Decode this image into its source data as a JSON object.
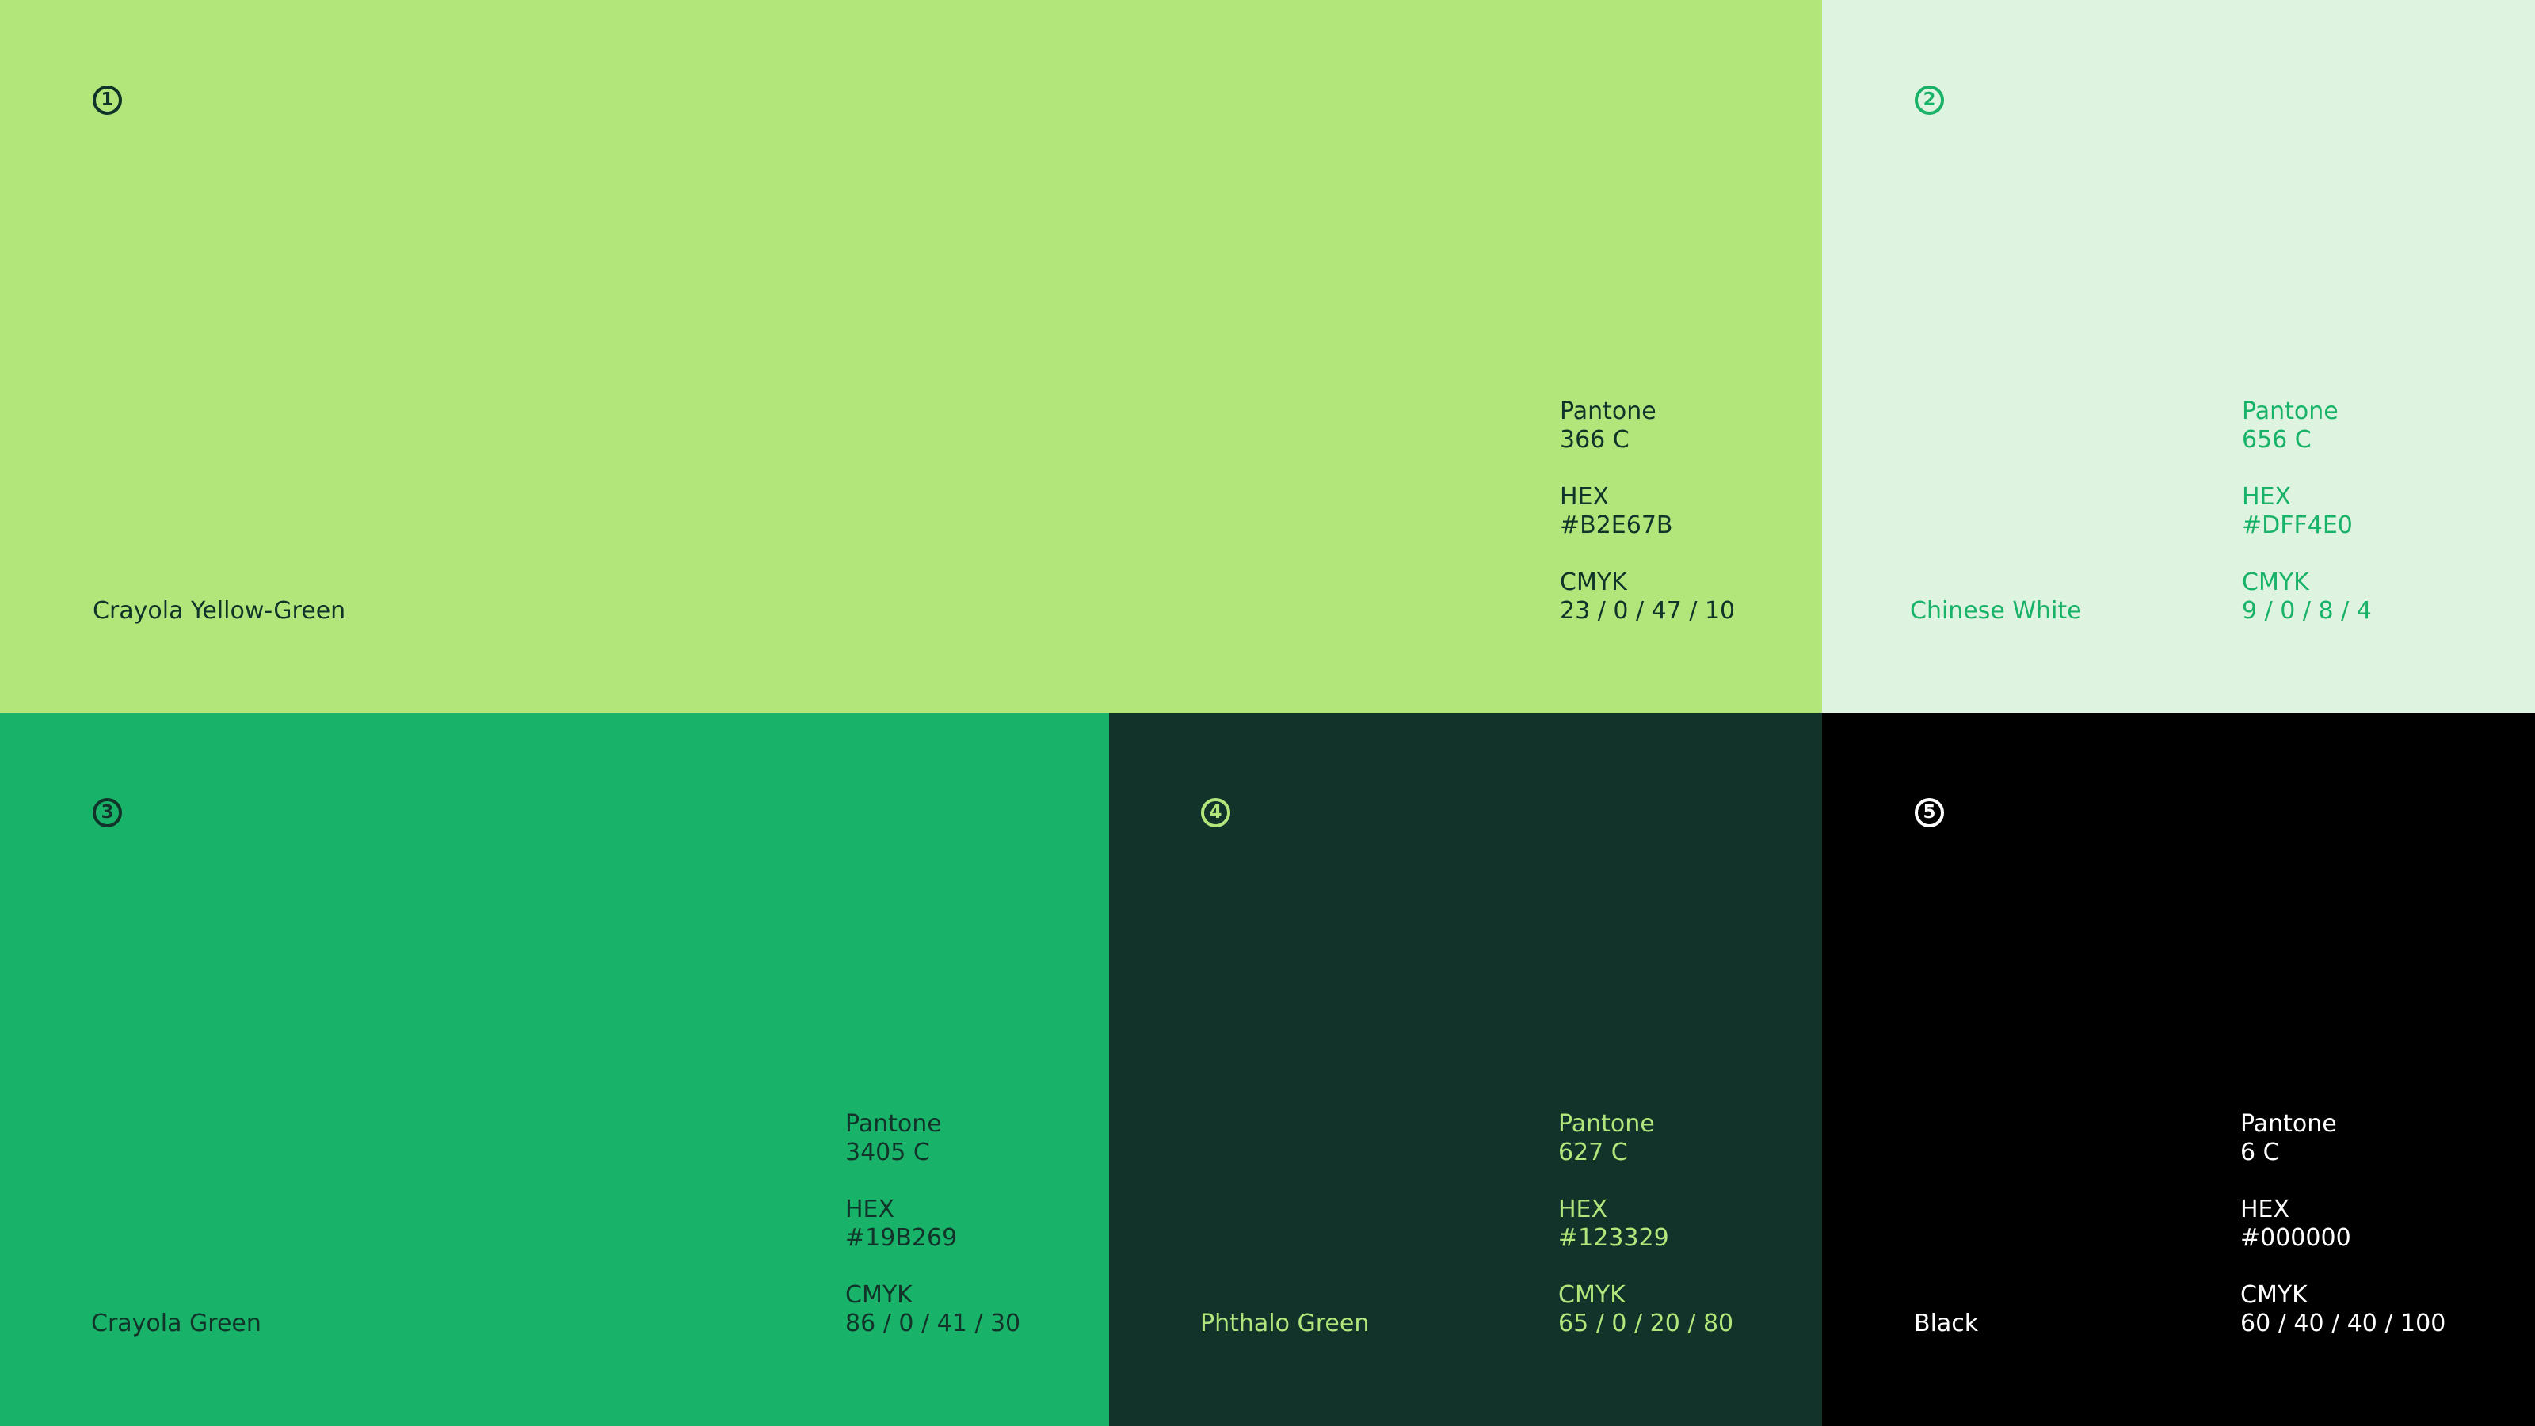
{
  "swatches": [
    {
      "number": "1",
      "name": "Crayola Yellow-Green",
      "pantone_label": "Pantone",
      "pantone": "366 C",
      "hex_label": "HEX",
      "hex": "#B2E67B",
      "cmyk_label": "CMYK",
      "cmyk": "23 / 0 / 47 / 10",
      "background": "#B2E67B",
      "text_color": "#123329"
    },
    {
      "number": "2",
      "name": "Chinese White",
      "pantone_label": "Pantone",
      "pantone": "656 C",
      "hex_label": "HEX",
      "hex": "#DFF4E0",
      "cmyk_label": "CMYK",
      "cmyk": "9 / 0 / 8 / 4",
      "background": "#DFF4E0",
      "text_color": "#19B269"
    },
    {
      "number": "3",
      "name": "Crayola Green",
      "pantone_label": "Pantone",
      "pantone": "3405 C",
      "hex_label": "HEX",
      "hex": "#19B269",
      "cmyk_label": "CMYK",
      "cmyk": "86 / 0 / 41 / 30",
      "background": "#19B269",
      "text_color": "#123329"
    },
    {
      "number": "4",
      "name": "Phthalo Green",
      "pantone_label": "Pantone",
      "pantone": "627 C",
      "hex_label": "HEX",
      "hex": "#123329",
      "cmyk_label": "CMYK",
      "cmyk": "65 / 0 / 20 / 80",
      "background": "#123329",
      "text_color": "#B2E67B"
    },
    {
      "number": "5",
      "name": "Black",
      "pantone_label": "Pantone",
      "pantone": "6 C",
      "hex_label": "HEX",
      "hex": "#000000",
      "cmyk_label": "CMYK",
      "cmyk": "60 / 40 / 40 / 100",
      "background": "#000000",
      "text_color": "#FFFFFF"
    }
  ]
}
